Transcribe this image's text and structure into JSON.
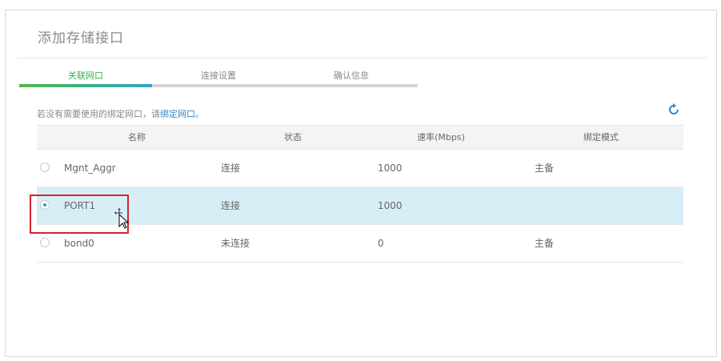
{
  "dialog": {
    "title": "添加存储接口"
  },
  "steps": [
    {
      "label": "关联网口",
      "active": true
    },
    {
      "label": "连接设置",
      "active": false
    },
    {
      "label": "确认信息",
      "active": false
    }
  ],
  "hint": {
    "text": "若没有需要使用的绑定网口，请",
    "link": "绑定网口",
    "suffix": "。"
  },
  "table": {
    "columns": [
      "名称",
      "状态",
      "速率(Mbps)",
      "绑定模式"
    ],
    "rows": [
      {
        "name": "Mgnt_Aggr",
        "status": "连接",
        "speed": "1000",
        "mode": "主备",
        "selected": false
      },
      {
        "name": "PORT1",
        "status": "连接",
        "speed": "1000",
        "mode": "",
        "selected": true
      },
      {
        "name": "bond0",
        "status": "未连接",
        "speed": "0",
        "mode": "主备",
        "selected": false
      }
    ]
  },
  "icons": {
    "refresh": "refresh-icon",
    "cursor": "move-cursor-icon"
  },
  "colors": {
    "accent_green": "#3ab54a",
    "accent_blue": "#2a88d0",
    "selected_row": "#d8eef7",
    "highlight": "#d4252f"
  },
  "progress": {
    "fraction": 0.333
  }
}
